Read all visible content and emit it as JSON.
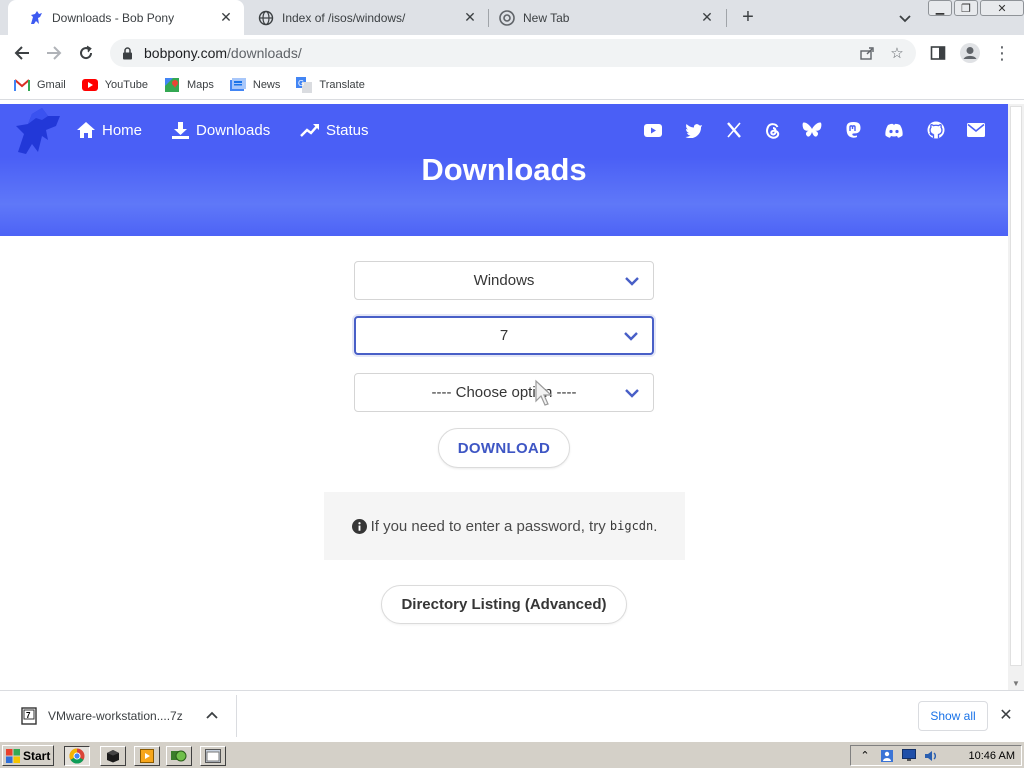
{
  "browser": {
    "tabs": [
      {
        "title": "Downloads - Bob Pony",
        "active": true
      },
      {
        "title": "Index of /isos/windows/",
        "active": false
      },
      {
        "title": "New Tab",
        "active": false
      }
    ],
    "newtab_label": "+",
    "url_host": "bobpony.com",
    "url_path": "/downloads/",
    "bookmarks": [
      {
        "label": "Gmail",
        "icon": "gmail-icon"
      },
      {
        "label": "YouTube",
        "icon": "youtube-icon"
      },
      {
        "label": "Maps",
        "icon": "maps-icon"
      },
      {
        "label": "News",
        "icon": "news-icon"
      },
      {
        "label": "Translate",
        "icon": "translate-icon"
      }
    ]
  },
  "site": {
    "nav": [
      {
        "label": "Home",
        "icon": "home-icon"
      },
      {
        "label": "Downloads",
        "icon": "download-icon"
      },
      {
        "label": "Status",
        "icon": "trending-up-icon"
      }
    ],
    "social_icons": [
      "youtube-icon",
      "twitter-icon",
      "x-icon",
      "threads-icon",
      "bluesky-icon",
      "mastodon-icon",
      "discord-icon",
      "github-icon",
      "mail-icon"
    ],
    "hero_title": "Downloads",
    "brand_color": "#4a5ff6"
  },
  "form": {
    "os_select": "Windows",
    "version_select": "7",
    "option_select": "---- Choose option ----",
    "download_button": "DOWNLOAD",
    "notice_text": "If you need to enter a password, try",
    "notice_code": "bigcdn",
    "notice_end": ".",
    "directory_button": "Directory Listing (Advanced)"
  },
  "download_shelf": {
    "file_name": "VMware-workstation....7z",
    "show_all": "Show all"
  },
  "taskbar": {
    "start_label": "Start",
    "clock": "10:46 AM"
  }
}
